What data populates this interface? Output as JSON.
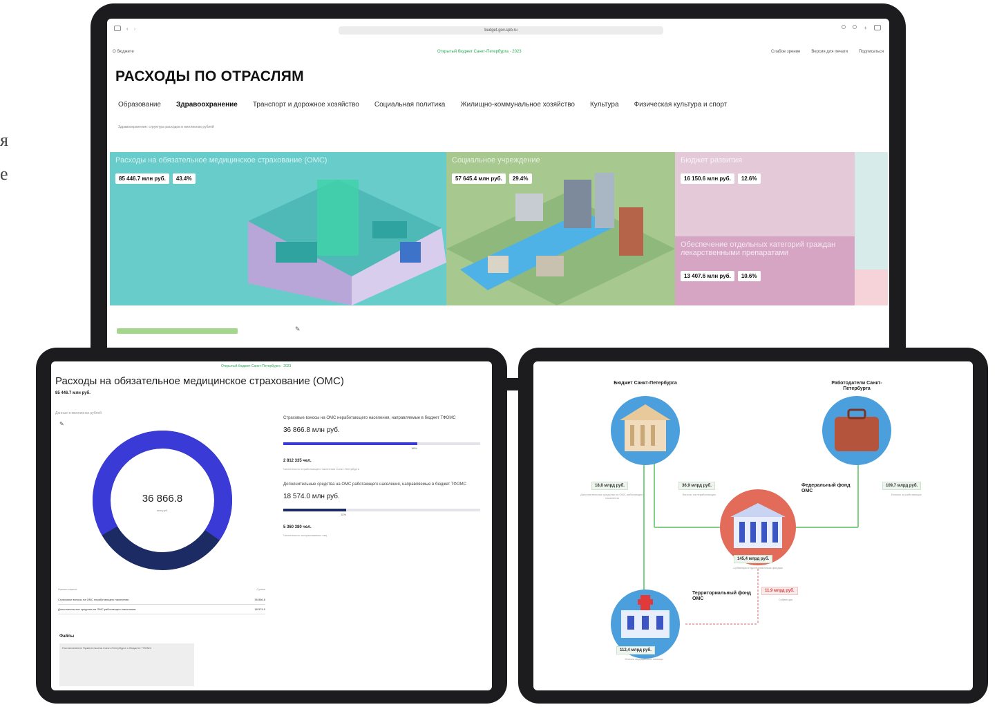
{
  "side_fragments": [
    "я",
    "е"
  ],
  "monitor": {
    "url": "budget.gov.spb.ru",
    "header": {
      "logo": "О бюджете",
      "center": "Открытый бюджет Санкт-Петербурга · 2023",
      "right": [
        "Слабое зрение",
        "Версия для печати",
        "Подписаться"
      ]
    },
    "title": "РАСХОДЫ ПО ОТРАСЛЯМ",
    "tabs": [
      "Образование",
      "Здравоохранение",
      "Транспорт и дорожное хозяйство",
      "Социальная политика",
      "Жилищно-коммунальное хозяйство",
      "Культура",
      "Физическая культура и спорт"
    ],
    "active_tab_index": 1,
    "subnote": "Здравоохранение: структура расходов в миллионах рублей",
    "tiles": [
      {
        "label": "Расходы на обязательное медицинское страхование (ОМС)",
        "amount": "85 446.7 млн руб.",
        "pct": "43.4%",
        "color": "#67ccca"
      },
      {
        "label": "Социальное учреждение",
        "amount": "57 645.4 млн руб.",
        "pct": "29.4%",
        "color": "#a7c88e"
      },
      {
        "label": "Бюджет развития",
        "amount": "16 150.6 млн руб.",
        "pct": "12.6%",
        "color": "#e4cad9"
      },
      {
        "label": "Обеспечение отдельных категорий граждан лекарственными препаратами",
        "amount": "13 407.6 млн руб.",
        "pct": "10.6%",
        "color": "#d5a5c3"
      }
    ]
  },
  "tablet_left": {
    "header_center": "Открытый бюджет Санкт-Петербурга · 2023",
    "title": "Расходы на обязательное медицинское страхование (ОМС)",
    "subtitle": "85 446.7 млн руб.",
    "note": "Данные в миллионах рублей",
    "donut": {
      "value": "36 866.8",
      "caption": "млн руб.",
      "share_primary": 0.68,
      "color_primary": "#3a3ad6",
      "color_secondary": "#1c2b63"
    },
    "bars": [
      {
        "desc": "Страховые взносы на ОМС неработающего населения, направляемые в бюджет ТФОМС",
        "value": "36 866.8 млн руб.",
        "fill": 0.68,
        "pct": "68%",
        "color": "#3a3ad6",
        "count": "2 812 335 чел.",
        "count_sub": "Численность неработающего населения Санкт-Петербурга"
      },
      {
        "desc": "Дополнительные средства на ОМС работающего населения, направляемые в бюджет ТФОМС",
        "value": "18 574.0 млн руб.",
        "fill": 0.32,
        "pct": "32%",
        "color": "#1c2b63",
        "count": "5 360 380 чел.",
        "count_sub": "Численность застрахованных лиц"
      }
    ],
    "table_head": [
      "Наименование",
      "Сумма"
    ],
    "table_rows": [
      {
        "name": "Страховые взносы на ОМС неработающего населения",
        "value": "36 866.8"
      },
      {
        "name": "Дополнительные средства на ОМС работающего населения",
        "value": "18 574.0"
      }
    ],
    "files_title": "Файлы",
    "file_text": "Постановление Правительства Санкт-Петербурга о бюджете ТФОМС"
  },
  "tablet_right": {
    "nodes": {
      "budget": "Бюджет Санкт-Петербурга",
      "employers": "Работодатели Санкт-Петербурга",
      "federal": "Федеральный фонд ОМС",
      "territorial": "Территориальный фонд ОМС"
    },
    "amounts": {
      "budget_left": "18,8 млрд руб.",
      "budget_right": "36,9 млрд руб.",
      "employers": "109,7 млрд руб.",
      "federal": "145,4 млрд руб.",
      "territorial": "112,4 млрд руб.",
      "transfer": "11,9 млрд руб."
    },
    "notes": {
      "budget_left": "Дополнительные средства на ОМС работающего населения",
      "budget_right": "Взносы на неработающих",
      "employers": "Взносы за работающих",
      "federal": "Субвенции территориальным фондам",
      "territorial": "Оплата медицинской помощи",
      "transfer": "Субвенция"
    }
  }
}
